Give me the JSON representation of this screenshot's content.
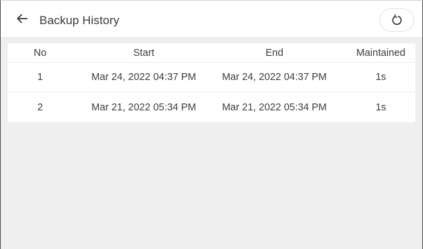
{
  "header": {
    "title": "Backup History",
    "back_icon": "arrow-left-icon",
    "refresh_icon": "refresh-icon"
  },
  "table": {
    "columns": [
      "No",
      "Start",
      "End",
      "Maintained"
    ],
    "rows": [
      {
        "no": "1",
        "start": "Mar 24, 2022 04:37 PM",
        "end": "Mar 24, 2022 04:37 PM",
        "maintained": "1s"
      },
      {
        "no": "2",
        "start": "Mar 21, 2022 05:34 PM",
        "end": "Mar 21, 2022 05:34 PM",
        "maintained": "1s"
      }
    ]
  },
  "colors": {
    "background": "#efefef",
    "surface": "#ffffff",
    "text": "#3d3d3d"
  }
}
